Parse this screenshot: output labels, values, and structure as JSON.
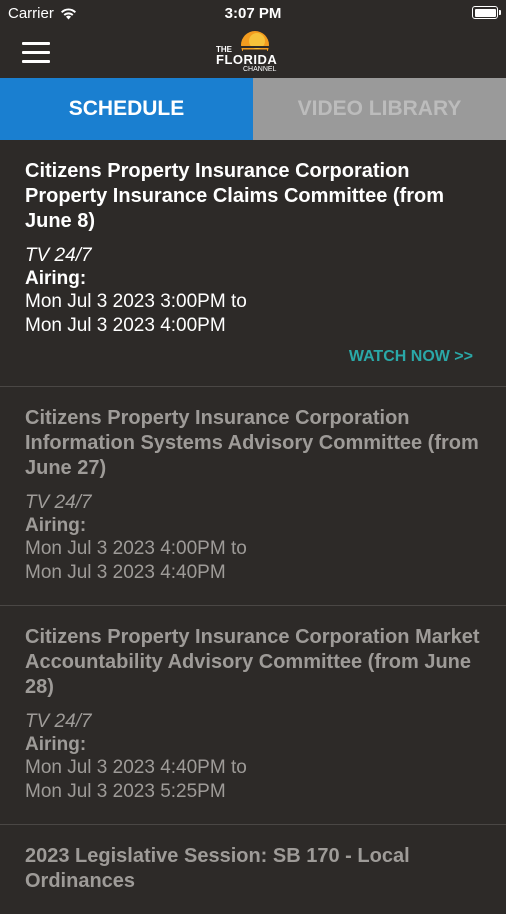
{
  "status_bar": {
    "carrier": "Carrier",
    "time": "3:07 PM"
  },
  "header": {
    "logo_the": "THE",
    "logo_florida": "FLORIDA",
    "logo_channel": "CHANNEL"
  },
  "tabs": [
    {
      "label": "SCHEDULE",
      "active": true
    },
    {
      "label": "VIDEO LIBRARY",
      "active": false
    }
  ],
  "items": [
    {
      "title": "Citizens Property Insurance Corporation Property Insurance Claims Committee (from June 8)",
      "channel": "TV 24/7",
      "airing_label": "Airing:",
      "start": "Mon Jul 3 2023 3:00PM to",
      "end": "Mon Jul 3 2023 4:00PM",
      "watch_label": "WATCH NOW >>"
    },
    {
      "title": "Citizens Property Insurance Corporation Information Systems Advisory Committee (from June 27)",
      "channel": "TV 24/7",
      "airing_label": "Airing:",
      "start": "Mon Jul 3 2023 4:00PM to",
      "end": "Mon Jul 3 2023 4:40PM"
    },
    {
      "title": "Citizens Property Insurance Corporation Market Accountability Advisory Committee (from June 28)",
      "channel": "TV 24/7",
      "airing_label": "Airing:",
      "start": "Mon Jul 3 2023 4:40PM to",
      "end": "Mon Jul 3 2023 5:25PM"
    },
    {
      "title": "2023 Legislative Session: SB 170 - Local Ordinances"
    }
  ],
  "colors": {
    "background": "#2d2a28",
    "tab_active": "#1a7fd0",
    "tab_inactive": "#9a9a9a",
    "watch_now": "#2aa8a8"
  }
}
